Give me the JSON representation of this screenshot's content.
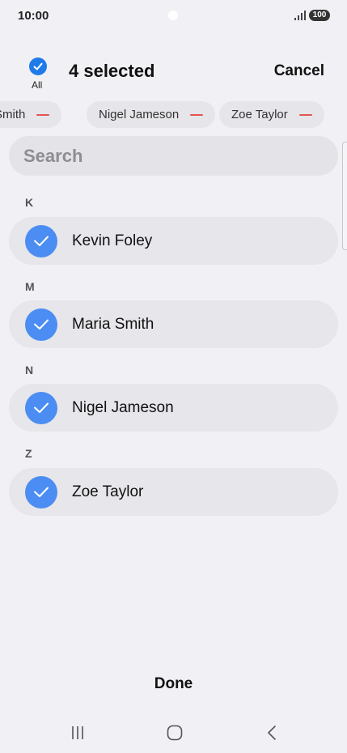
{
  "status_bar": {
    "time": "10:00",
    "battery": "100"
  },
  "header": {
    "all_label": "All",
    "selected_title": "4 selected",
    "cancel_label": "Cancel"
  },
  "chips": [
    {
      "label": "Smith"
    },
    {
      "label": "Nigel Jameson"
    },
    {
      "label": "Zoe Taylor"
    }
  ],
  "search": {
    "placeholder": "Search"
  },
  "sections": [
    {
      "letter": "K",
      "contacts": [
        {
          "name": "Kevin Foley",
          "selected": true
        }
      ]
    },
    {
      "letter": "M",
      "contacts": [
        {
          "name": "Maria Smith",
          "selected": true
        }
      ]
    },
    {
      "letter": "N",
      "contacts": [
        {
          "name": "Nigel Jameson",
          "selected": true
        }
      ]
    },
    {
      "letter": "Z",
      "contacts": [
        {
          "name": "Zoe Taylor",
          "selected": true
        }
      ]
    }
  ],
  "footer": {
    "done_label": "Done"
  },
  "colors": {
    "accent": "#1f7be8",
    "check_fill": "#4b8df2",
    "remove": "#e5544f",
    "background": "#f1f1f5"
  },
  "icons": {
    "signal": "signal-icon",
    "battery": "battery-icon",
    "check": "check-icon",
    "remove": "minus-icon",
    "recents": "recents-icon",
    "home": "home-icon",
    "back": "back-icon"
  }
}
